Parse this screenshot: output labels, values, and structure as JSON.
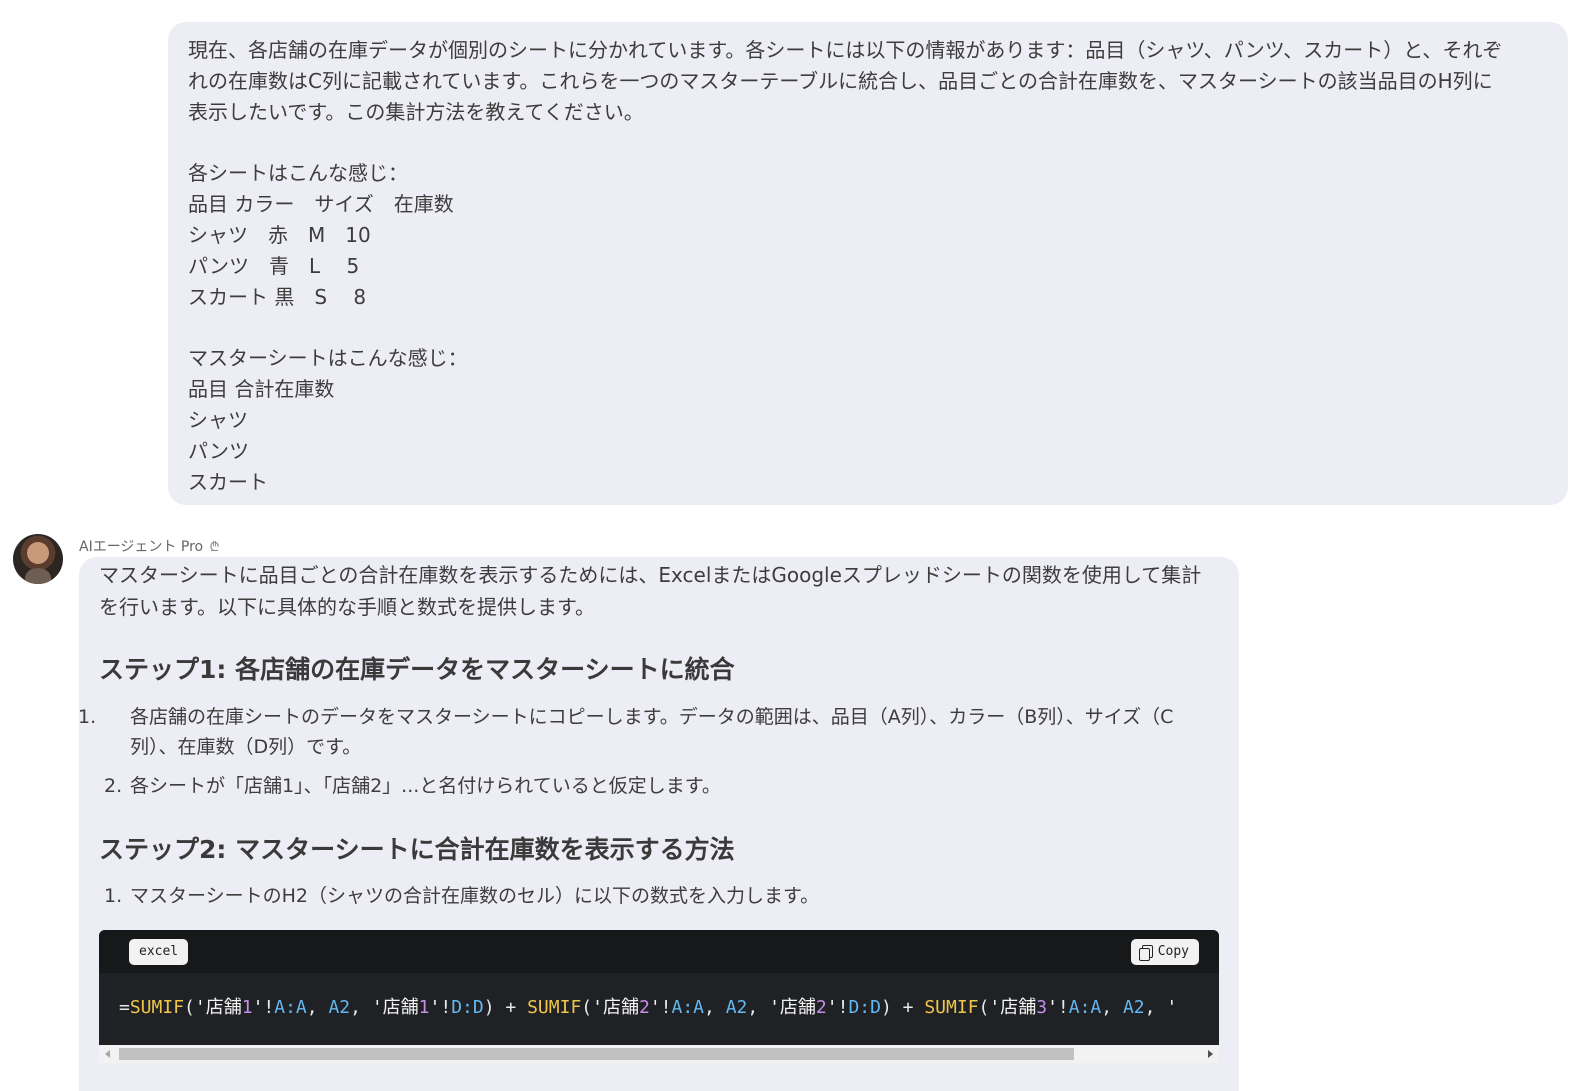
{
  "user_message": {
    "lines": [
      "現在、各店舗の在庫データが個別のシートに分かれています。各シートには以下の情報があります：品目（シャツ、パンツ、スカート）と、それぞ",
      "れの在庫数はC列に記載されています。これらを一つのマスターテーブルに統合し、品目ごとの合計在庫数を、マスターシートの該当品目のH列に",
      "表示したいです。この集計方法を教えてください。",
      "",
      "各シートはこんな感じ：",
      "品目 カラー　サイズ　在庫数",
      "シャツ　赤　M　10",
      "パンツ　青　L　 5",
      "スカート 黒　S　 8",
      "",
      "マスターシートはこんな感じ：",
      "品目 合計在庫数",
      "シャツ",
      "パンツ",
      "スカート"
    ]
  },
  "assistant": {
    "name": "AIエージェント Pro",
    "name_icon": "group-icon",
    "intro": "マスターシートに品目ごとの合計在庫数を表示するためには、ExcelまたはGoogleスプレッドシートの関数を使用して集計を行います。以下に具体的な手順と数式を提供します。",
    "step1": {
      "heading": "ステップ1: 各店舗の在庫データをマスターシートに統合",
      "items": [
        {
          "num": "1.",
          "text": "各店舗の在庫シートのデータをマスターシートにコピーします。データの範囲は、品目（A列）、カラー（B列）、サイズ（C列）、在庫数（D列）です。"
        },
        {
          "num": "2.",
          "text": "各シートが「店舗1」、「店舗2」...と名付けられていると仮定します。"
        }
      ]
    },
    "step2": {
      "heading": "ステップ2: マスターシートに合計在庫数を表示する方法",
      "items": [
        {
          "num": "1.",
          "text": "マスターシートのH2（シャツの合計在庫数のセル）に以下の数式を入力します。"
        }
      ]
    },
    "code": {
      "language": "excel",
      "copy_label": "Copy",
      "copy_icon": "copy-icon",
      "formula": "=SUMIF('店舗1'!A:A, A2, '店舗1'!D:D) + SUMIF('店舗2'!A:A, A2, '店舗2'!D:D) + SUMIF('店舗3'!A:A, A2, '"
    }
  },
  "colors": {
    "bubble_bg": "#ededf5",
    "code_bg": "#1f2124",
    "code_fn": "#f0c64a",
    "code_num": "#c78ee6",
    "code_ref": "#63b8f0"
  }
}
